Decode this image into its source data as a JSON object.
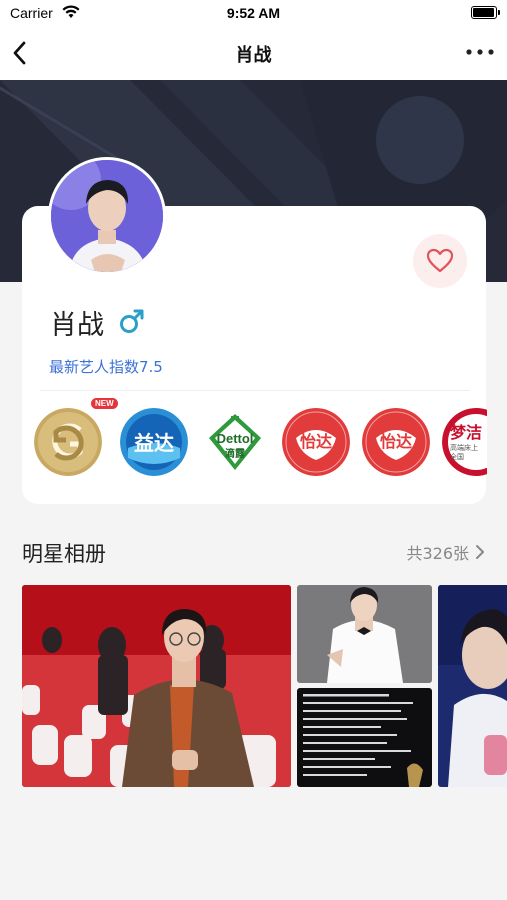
{
  "status_bar": {
    "carrier": "Carrier",
    "time": "9:52 AM",
    "battery_level": 0.95
  },
  "nav": {
    "title": "肖战",
    "back_icon": "chevron-left-icon",
    "more_icon": "ellipsis-icon"
  },
  "profile": {
    "name": "肖战",
    "gender_icon": "male-symbol-icon",
    "artist_index": "最新艺人指数7.5",
    "favorite_icon": "heart-outline-icon"
  },
  "brands": {
    "new_badge": "NEW",
    "items": [
      {
        "name": "gucci-logo"
      },
      {
        "name": "yida-gum-logo",
        "text": "益达"
      },
      {
        "name": "dettol-logo",
        "text": "Dettol",
        "sub": "滴露"
      },
      {
        "name": "yida-logo-1",
        "text": "怡达"
      },
      {
        "name": "yida-logo-2",
        "text": "怡达"
      },
      {
        "name": "mengjie-logo",
        "text": "梦洁",
        "sub1": "高端床上",
        "sub2": "全国"
      }
    ]
  },
  "album": {
    "title": "明星相册",
    "count": "共326张",
    "chevron_icon": "chevron-right-icon"
  },
  "colors": {
    "accent_blue": "#3d72d6",
    "heart_red": "#e0555c",
    "banner_dark": "#262a38"
  }
}
